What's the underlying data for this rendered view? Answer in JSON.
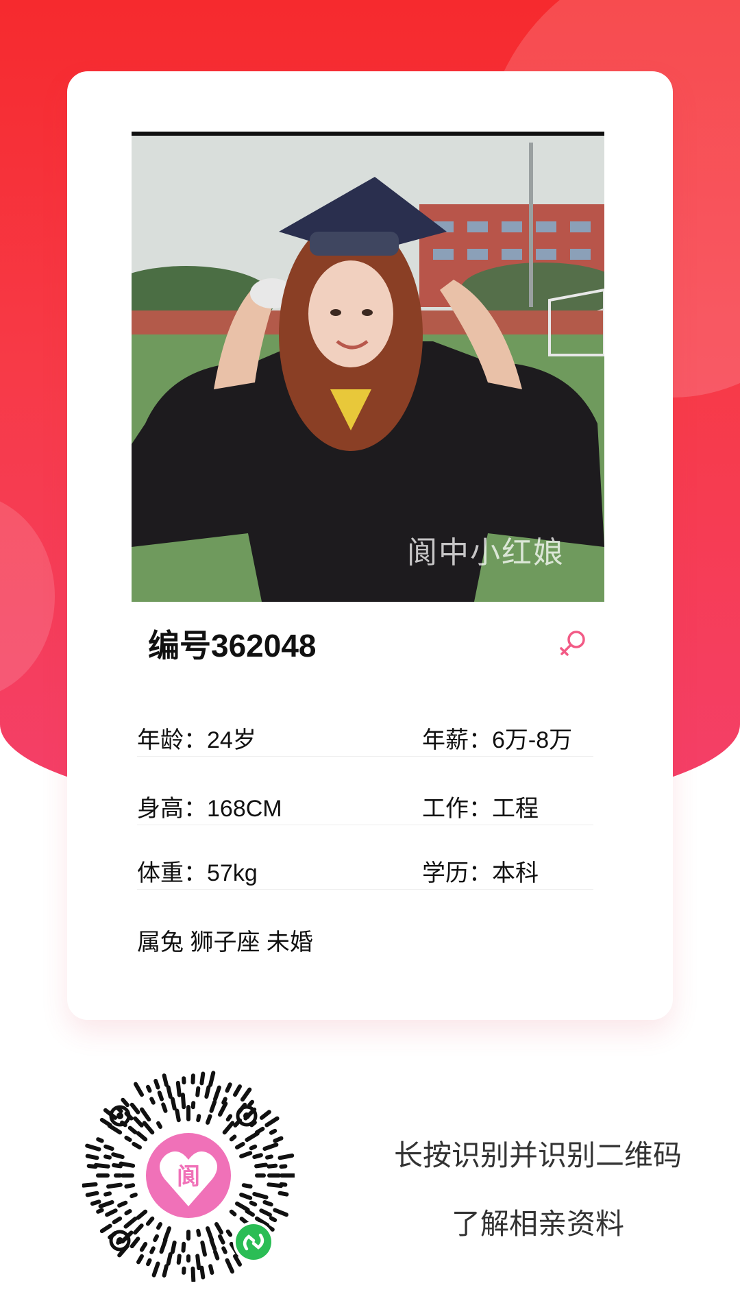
{
  "profile": {
    "id_label": "编号362048",
    "photo_watermark": "阆中小红娘",
    "gender": "female"
  },
  "info": {
    "rows": [
      {
        "left": "年龄：24岁",
        "right": "年薪：6万-8万"
      },
      {
        "left": "身高：168CM",
        "right": "工作：工程"
      },
      {
        "left": "体重：57kg",
        "right": "学历：本科"
      },
      {
        "left": "属兔 狮子座 未婚",
        "right": ""
      }
    ]
  },
  "footer": {
    "prompt_line1": "长按识别并识别二维码",
    "prompt_line2": "了解相亲资料",
    "qr_logo_text": "阆"
  },
  "colors": {
    "accent_red": "#f62a2e",
    "accent_pink": "#f4406a",
    "gender_icon": "#f25b86",
    "qr_center": "#f071b8",
    "mini_program_badge": "#2bbd55"
  }
}
